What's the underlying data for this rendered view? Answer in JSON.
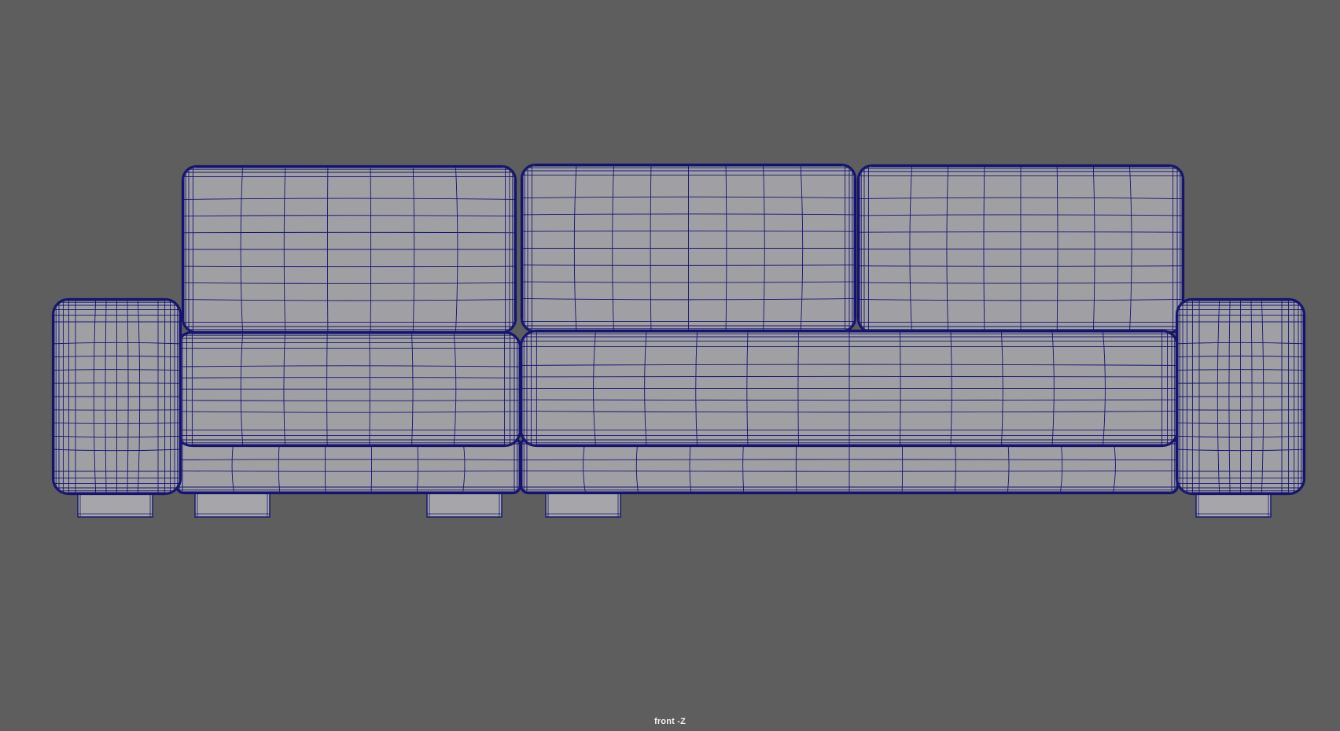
{
  "viewport": {
    "camera_label": "front -Z",
    "background_color": "#5e5e5e",
    "mesh_fill_color": "#a0a0a4",
    "wireframe_color": "#14146e"
  },
  "model": {
    "name": "sofa",
    "display_mode": "wireframe-on-shaded"
  }
}
